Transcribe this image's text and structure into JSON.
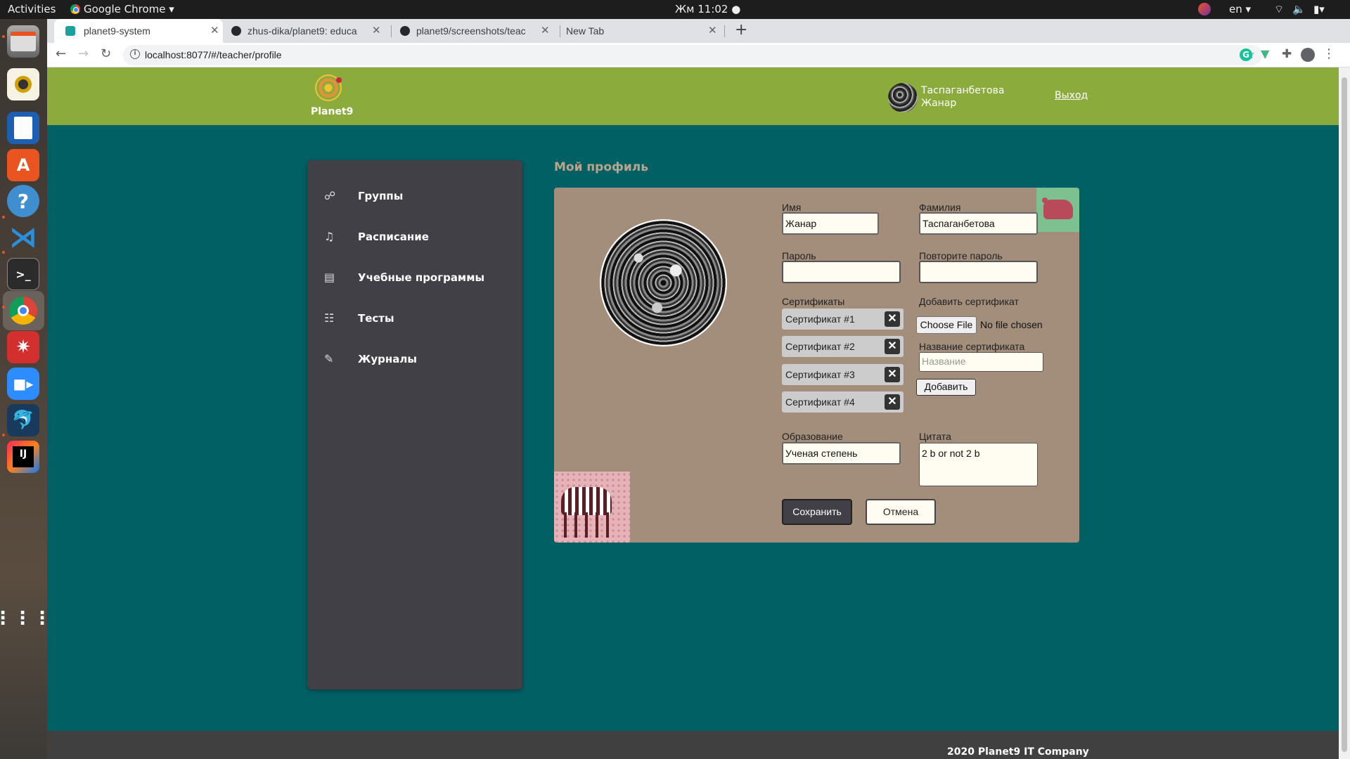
{
  "os": {
    "activities": "Activities",
    "app_menu": "Google Chrome",
    "clock": "Жм 11:02",
    "lang": "en"
  },
  "browser": {
    "tabs": [
      {
        "title": "planet9-system",
        "active": true
      },
      {
        "title": "zhus-dika/planet9: educa",
        "active": false
      },
      {
        "title": "planet9/screenshots/teac",
        "active": false
      },
      {
        "title": "New Tab",
        "active": false
      }
    ],
    "url": "localhost:8077/#/teacher/profile"
  },
  "site": {
    "logo": "Planet9",
    "user_name": [
      "Таспаганбетова",
      "Жанар"
    ],
    "logout": "Выход",
    "footer": "2020 Planet9 IT Company"
  },
  "sidebar": {
    "items": [
      {
        "label": "Группы",
        "icon": "groups-icon"
      },
      {
        "label": "Расписание",
        "icon": "bell-icon"
      },
      {
        "label": "Учебные программы",
        "icon": "document-icon"
      },
      {
        "label": "Тесты",
        "icon": "checklist-icon"
      },
      {
        "label": "Журналы",
        "icon": "journal-icon"
      }
    ]
  },
  "profile": {
    "title": "Мой профиль",
    "first_name_label": "Имя",
    "first_name": "Жанар",
    "last_name_label": "Фамилия",
    "last_name": "Таспаганбетова",
    "password_label": "Пароль",
    "password": "",
    "repeat_password_label": "Повторите пароль",
    "repeat_password": "",
    "certificates_label": "Сертификаты",
    "certificates": [
      "Сертификат #1",
      "Сертификат #2",
      "Сертификат #3",
      "Сертификат #4"
    ],
    "add_certificate_label": "Добавить сертификат",
    "choose_file": "Choose File",
    "no_file": "No file chosen",
    "cert_name_label": "Название сертификата",
    "cert_name_placeholder": "Название",
    "add_button": "Добавить",
    "education_label": "Образование",
    "education": "Ученая степень",
    "quote_label": "Цитата",
    "quote": "2 b or not 2 b",
    "save_button": "Сохранить",
    "cancel_button": "Отмена"
  }
}
